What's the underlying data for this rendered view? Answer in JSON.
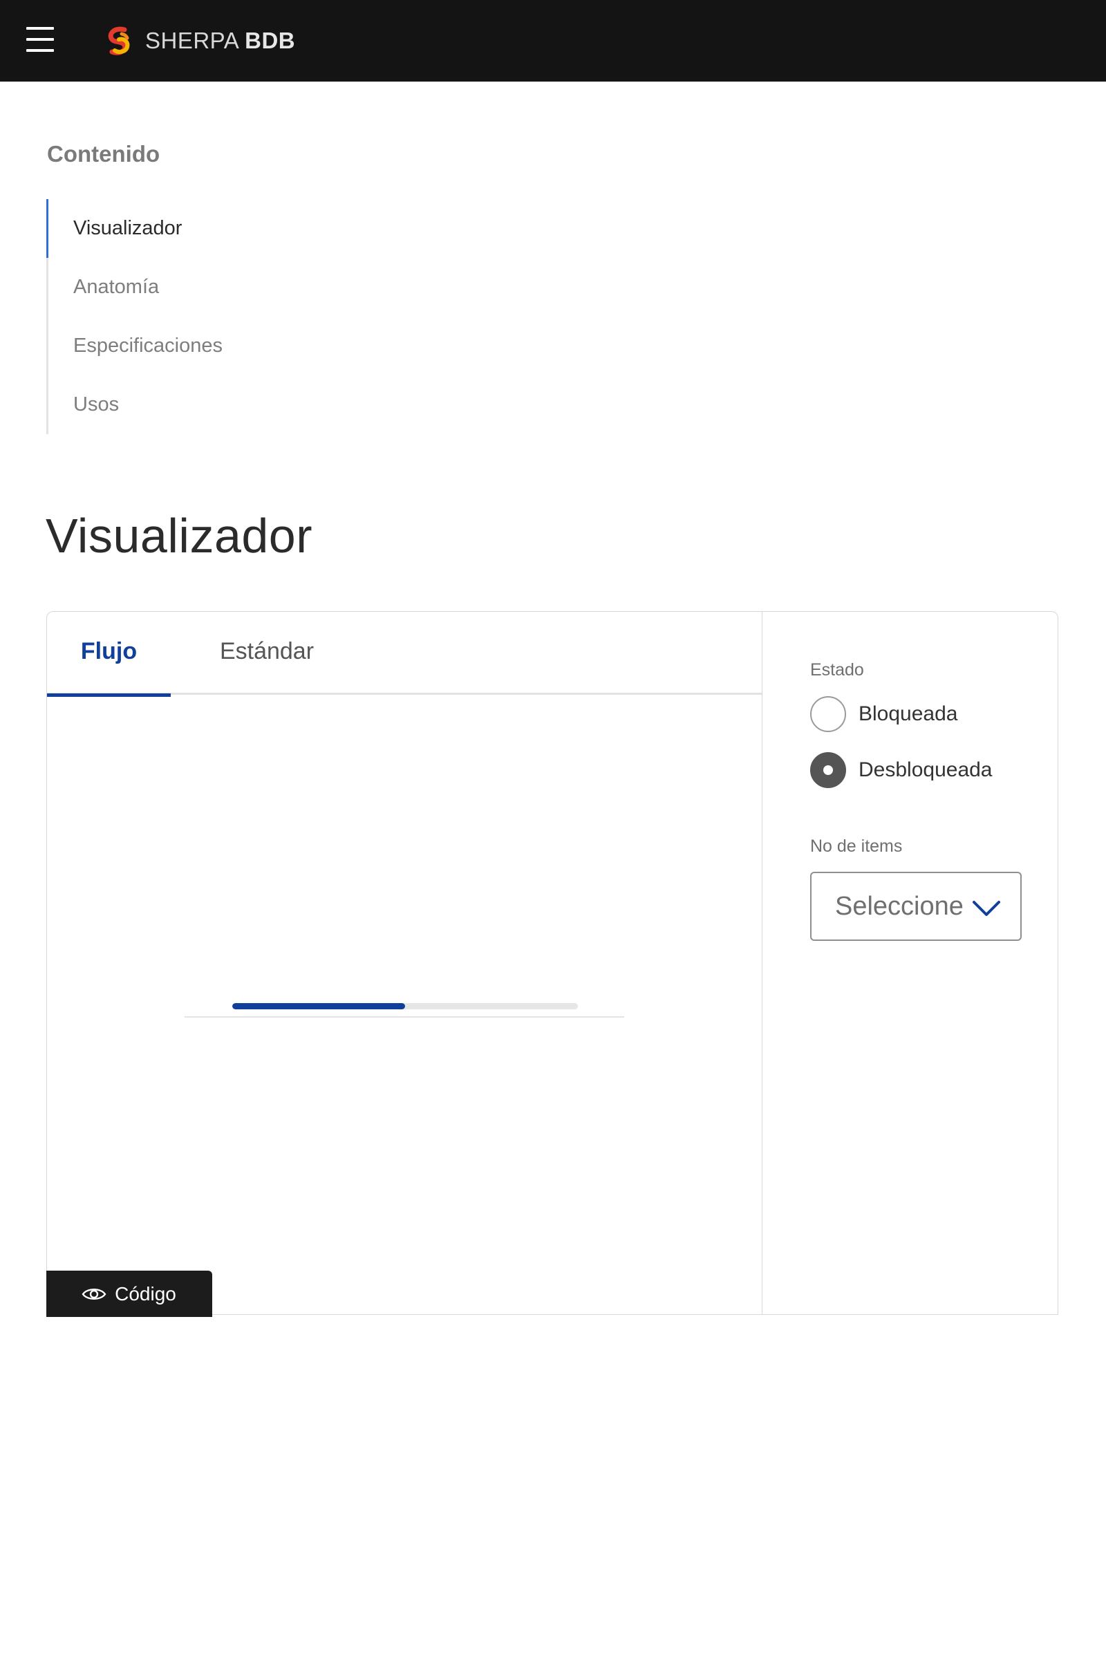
{
  "header": {
    "brand_name": "SHERPA",
    "brand_suffix": "BDB",
    "menu_icon": "hamburger-menu-icon",
    "logo_icon": "sherpa-logo-icon"
  },
  "nav": {
    "title": "Contenido",
    "items": [
      {
        "label": "Visualizador",
        "active": true
      },
      {
        "label": "Anatomía",
        "active": false
      },
      {
        "label": "Especificaciones",
        "active": false
      },
      {
        "label": "Usos",
        "active": false
      }
    ]
  },
  "page": {
    "title": "Visualizador"
  },
  "viewer": {
    "tabs": [
      {
        "label": "Flujo",
        "active": true
      },
      {
        "label": "Estándar",
        "active": false
      }
    ],
    "preview": {
      "progress_percent": 50
    },
    "code_button": {
      "label": "Código",
      "icon": "eye-icon"
    },
    "controls": {
      "estado_label": "Estado",
      "options": [
        {
          "label": "Bloqueada",
          "checked": false
        },
        {
          "label": "Desbloqueada",
          "checked": true
        }
      ],
      "items_label": "No de items",
      "select_value": "Seleccione",
      "select_icon": "chevron-down-icon"
    }
  },
  "colors": {
    "topbar": "#141414",
    "accent": "#10409a",
    "nav_active": "#2f6fd6"
  }
}
